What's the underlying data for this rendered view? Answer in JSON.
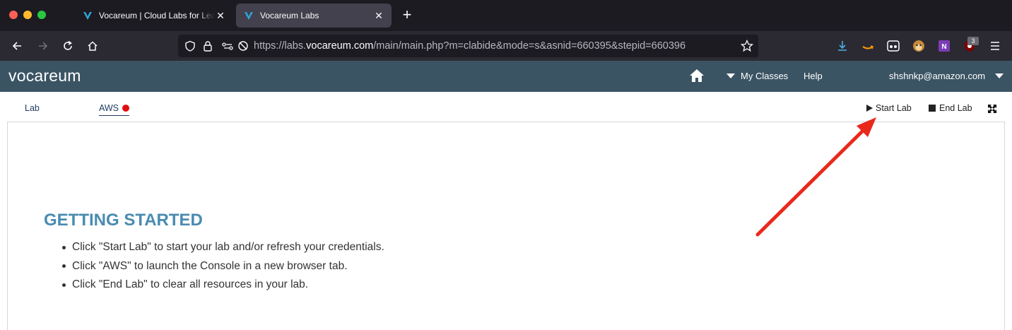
{
  "browser": {
    "tabs": [
      {
        "title": "Vocareum | Cloud Labs for Learning",
        "active": false
      },
      {
        "title": "Vocareum Labs",
        "active": true
      }
    ],
    "url": {
      "prefix": "https://labs.",
      "host": "vocareum.com",
      "path": "/main/main.php?m=clabide&mode=s&asnid=660395&stepid=660396"
    },
    "extension_badge": "3"
  },
  "app": {
    "logo": "vocareum",
    "nav": {
      "my_classes": "My Classes",
      "help": "Help",
      "user": "shshnkp@amazon.com"
    }
  },
  "toolbar": {
    "tab_lab": "Lab",
    "tab_aws": "AWS",
    "start_lab": "Start Lab",
    "end_lab": "End Lab"
  },
  "content": {
    "title": "GETTING STARTED",
    "items": [
      "Click \"Start Lab\" to start your lab and/or refresh your credentials.",
      "Click \"AWS\" to launch the Console in a new browser tab.",
      "Click \"End Lab\" to clear all resources in your lab."
    ]
  },
  "colors": {
    "app_header": "#3b5464",
    "title_accent": "#4a8bb1",
    "aws_status_dot": "#e01010",
    "annotation_arrow": "#e8291c"
  }
}
